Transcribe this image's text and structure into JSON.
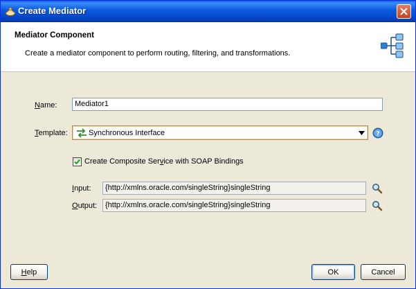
{
  "window": {
    "title": "Create Mediator",
    "close_icon": "close-icon"
  },
  "header": {
    "title": "Mediator Component",
    "description": "Create a mediator component to perform routing, filtering, and transformations.",
    "graphic_icon": "mediator-routing-icon"
  },
  "form": {
    "name": {
      "label_pre": "",
      "label_key": "N",
      "label_post": "ame:",
      "value": "Mediator1"
    },
    "template": {
      "label_pre": "",
      "label_key": "T",
      "label_post": "emplate:",
      "value": "Synchronous Interface",
      "icon": "synchronous-arrows-icon",
      "help_icon": "help-icon"
    },
    "composite": {
      "label_pre": "Create Composite Ser",
      "label_key": "v",
      "label_post": "ice with SOAP Bindings",
      "checked": true
    },
    "input": {
      "label_pre": "",
      "label_key": "I",
      "label_post": "nput:",
      "value": "{http://xmlns.oracle.com/singleString}singleString",
      "browse_icon": "search-icon"
    },
    "output": {
      "label_pre": "",
      "label_key": "O",
      "label_post": "utput:",
      "value": "{http://xmlns.oracle.com/singleString}singleString",
      "browse_icon": "search-icon"
    }
  },
  "buttons": {
    "help_pre": "",
    "help_key": "H",
    "help_post": "elp",
    "ok": "OK",
    "cancel": "Cancel"
  },
  "colors": {
    "titlebar": "#0a5bdf",
    "dialog_bg": "#ece9d8",
    "header_bg": "#ffffff",
    "close_red": "#c8401f"
  }
}
